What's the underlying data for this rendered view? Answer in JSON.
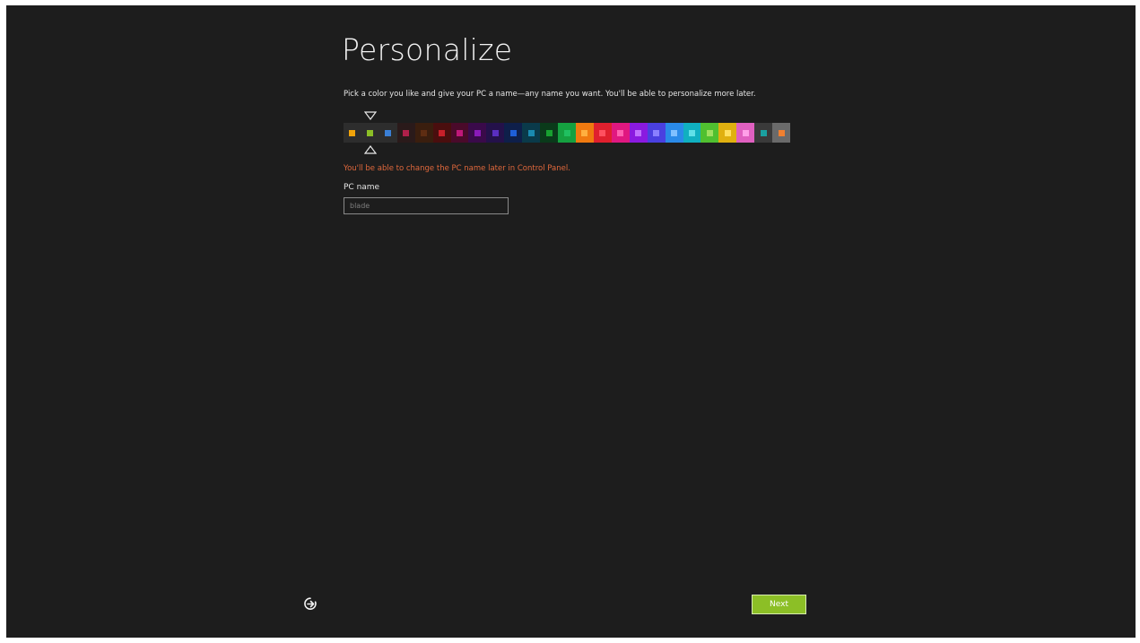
{
  "page": {
    "title": "Personalize",
    "instructions": "Pick a color you like and give your PC a name—any name you want. You'll be able to personalize more later.",
    "note": "You'll be able to change the PC name later in Control Panel.",
    "pc_name_label": "PC name",
    "pc_name_value": "",
    "pc_name_placeholder": "blade",
    "next_label": "Next"
  },
  "colors": {
    "background": "#1d1d1d",
    "note_text": "#e0683c",
    "next_button": "#8cbf26"
  },
  "palette": {
    "selected_index": 1,
    "swatches": [
      {
        "bg": "#2d2d2d",
        "accent": "#f0a30a"
      },
      {
        "bg": "#2d2d2d",
        "accent": "#8cbf26"
      },
      {
        "bg": "#2d2d2d",
        "accent": "#3a7fd5"
      },
      {
        "bg": "#2a1a1a",
        "accent": "#b0204a"
      },
      {
        "bg": "#3a1e0e",
        "accent": "#5e2d12"
      },
      {
        "bg": "#4a0e0e",
        "accent": "#c8202a"
      },
      {
        "bg": "#4a0a2a",
        "accent": "#c0187a"
      },
      {
        "bg": "#3a0a4a",
        "accent": "#8a1ab8"
      },
      {
        "bg": "#24114a",
        "accent": "#5a2ec0"
      },
      {
        "bg": "#0e1f4a",
        "accent": "#1e5fd8"
      },
      {
        "bg": "#0a3a4a",
        "accent": "#1a8ab0"
      },
      {
        "bg": "#0a3a1a",
        "accent": "#18a030"
      },
      {
        "bg": "#15a040",
        "accent": "#20c060"
      },
      {
        "bg": "#f07a10",
        "accent": "#ffb040"
      },
      {
        "bg": "#e0202e",
        "accent": "#ff5060"
      },
      {
        "bg": "#e01880",
        "accent": "#ff60b0"
      },
      {
        "bg": "#8a1ae0",
        "accent": "#c070ff"
      },
      {
        "bg": "#4a40e0",
        "accent": "#8a80ff"
      },
      {
        "bg": "#2a8ae8",
        "accent": "#80c0ff"
      },
      {
        "bg": "#10b0c0",
        "accent": "#60e0e8"
      },
      {
        "bg": "#50c030",
        "accent": "#a0e060"
      },
      {
        "bg": "#e0b010",
        "accent": "#ffe060"
      },
      {
        "bg": "#e060c0",
        "accent": "#ffa0e8"
      },
      {
        "bg": "#3a3a3a",
        "accent": "#1aa0a0"
      },
      {
        "bg": "#6a6a6a",
        "accent": "#f08030"
      }
    ]
  },
  "icons": {
    "ease_of_access": "ease-of-access-icon",
    "selector": "triangle-icon"
  }
}
